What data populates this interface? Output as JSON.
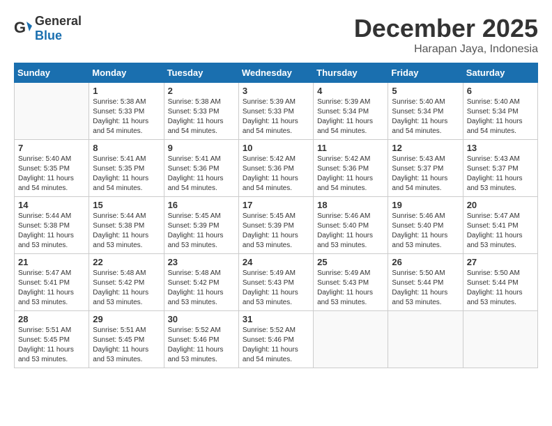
{
  "header": {
    "logo_general": "General",
    "logo_blue": "Blue",
    "month": "December 2025",
    "location": "Harapan Jaya, Indonesia"
  },
  "weekdays": [
    "Sunday",
    "Monday",
    "Tuesday",
    "Wednesday",
    "Thursday",
    "Friday",
    "Saturday"
  ],
  "weeks": [
    [
      {
        "day": "",
        "sunrise": "",
        "sunset": "",
        "daylight": ""
      },
      {
        "day": "1",
        "sunrise": "Sunrise: 5:38 AM",
        "sunset": "Sunset: 5:33 PM",
        "daylight": "Daylight: 11 hours and 54 minutes."
      },
      {
        "day": "2",
        "sunrise": "Sunrise: 5:38 AM",
        "sunset": "Sunset: 5:33 PM",
        "daylight": "Daylight: 11 hours and 54 minutes."
      },
      {
        "day": "3",
        "sunrise": "Sunrise: 5:39 AM",
        "sunset": "Sunset: 5:33 PM",
        "daylight": "Daylight: 11 hours and 54 minutes."
      },
      {
        "day": "4",
        "sunrise": "Sunrise: 5:39 AM",
        "sunset": "Sunset: 5:34 PM",
        "daylight": "Daylight: 11 hours and 54 minutes."
      },
      {
        "day": "5",
        "sunrise": "Sunrise: 5:40 AM",
        "sunset": "Sunset: 5:34 PM",
        "daylight": "Daylight: 11 hours and 54 minutes."
      },
      {
        "day": "6",
        "sunrise": "Sunrise: 5:40 AM",
        "sunset": "Sunset: 5:34 PM",
        "daylight": "Daylight: 11 hours and 54 minutes."
      }
    ],
    [
      {
        "day": "7",
        "sunrise": "Sunrise: 5:40 AM",
        "sunset": "Sunset: 5:35 PM",
        "daylight": "Daylight: 11 hours and 54 minutes."
      },
      {
        "day": "8",
        "sunrise": "Sunrise: 5:41 AM",
        "sunset": "Sunset: 5:35 PM",
        "daylight": "Daylight: 11 hours and 54 minutes."
      },
      {
        "day": "9",
        "sunrise": "Sunrise: 5:41 AM",
        "sunset": "Sunset: 5:36 PM",
        "daylight": "Daylight: 11 hours and 54 minutes."
      },
      {
        "day": "10",
        "sunrise": "Sunrise: 5:42 AM",
        "sunset": "Sunset: 5:36 PM",
        "daylight": "Daylight: 11 hours and 54 minutes."
      },
      {
        "day": "11",
        "sunrise": "Sunrise: 5:42 AM",
        "sunset": "Sunset: 5:36 PM",
        "daylight": "Daylight: 11 hours and 54 minutes."
      },
      {
        "day": "12",
        "sunrise": "Sunrise: 5:43 AM",
        "sunset": "Sunset: 5:37 PM",
        "daylight": "Daylight: 11 hours and 54 minutes."
      },
      {
        "day": "13",
        "sunrise": "Sunrise: 5:43 AM",
        "sunset": "Sunset: 5:37 PM",
        "daylight": "Daylight: 11 hours and 53 minutes."
      }
    ],
    [
      {
        "day": "14",
        "sunrise": "Sunrise: 5:44 AM",
        "sunset": "Sunset: 5:38 PM",
        "daylight": "Daylight: 11 hours and 53 minutes."
      },
      {
        "day": "15",
        "sunrise": "Sunrise: 5:44 AM",
        "sunset": "Sunset: 5:38 PM",
        "daylight": "Daylight: 11 hours and 53 minutes."
      },
      {
        "day": "16",
        "sunrise": "Sunrise: 5:45 AM",
        "sunset": "Sunset: 5:39 PM",
        "daylight": "Daylight: 11 hours and 53 minutes."
      },
      {
        "day": "17",
        "sunrise": "Sunrise: 5:45 AM",
        "sunset": "Sunset: 5:39 PM",
        "daylight": "Daylight: 11 hours and 53 minutes."
      },
      {
        "day": "18",
        "sunrise": "Sunrise: 5:46 AM",
        "sunset": "Sunset: 5:40 PM",
        "daylight": "Daylight: 11 hours and 53 minutes."
      },
      {
        "day": "19",
        "sunrise": "Sunrise: 5:46 AM",
        "sunset": "Sunset: 5:40 PM",
        "daylight": "Daylight: 11 hours and 53 minutes."
      },
      {
        "day": "20",
        "sunrise": "Sunrise: 5:47 AM",
        "sunset": "Sunset: 5:41 PM",
        "daylight": "Daylight: 11 hours and 53 minutes."
      }
    ],
    [
      {
        "day": "21",
        "sunrise": "Sunrise: 5:47 AM",
        "sunset": "Sunset: 5:41 PM",
        "daylight": "Daylight: 11 hours and 53 minutes."
      },
      {
        "day": "22",
        "sunrise": "Sunrise: 5:48 AM",
        "sunset": "Sunset: 5:42 PM",
        "daylight": "Daylight: 11 hours and 53 minutes."
      },
      {
        "day": "23",
        "sunrise": "Sunrise: 5:48 AM",
        "sunset": "Sunset: 5:42 PM",
        "daylight": "Daylight: 11 hours and 53 minutes."
      },
      {
        "day": "24",
        "sunrise": "Sunrise: 5:49 AM",
        "sunset": "Sunset: 5:43 PM",
        "daylight": "Daylight: 11 hours and 53 minutes."
      },
      {
        "day": "25",
        "sunrise": "Sunrise: 5:49 AM",
        "sunset": "Sunset: 5:43 PM",
        "daylight": "Daylight: 11 hours and 53 minutes."
      },
      {
        "day": "26",
        "sunrise": "Sunrise: 5:50 AM",
        "sunset": "Sunset: 5:44 PM",
        "daylight": "Daylight: 11 hours and 53 minutes."
      },
      {
        "day": "27",
        "sunrise": "Sunrise: 5:50 AM",
        "sunset": "Sunset: 5:44 PM",
        "daylight": "Daylight: 11 hours and 53 minutes."
      }
    ],
    [
      {
        "day": "28",
        "sunrise": "Sunrise: 5:51 AM",
        "sunset": "Sunset: 5:45 PM",
        "daylight": "Daylight: 11 hours and 53 minutes."
      },
      {
        "day": "29",
        "sunrise": "Sunrise: 5:51 AM",
        "sunset": "Sunset: 5:45 PM",
        "daylight": "Daylight: 11 hours and 53 minutes."
      },
      {
        "day": "30",
        "sunrise": "Sunrise: 5:52 AM",
        "sunset": "Sunset: 5:46 PM",
        "daylight": "Daylight: 11 hours and 53 minutes."
      },
      {
        "day": "31",
        "sunrise": "Sunrise: 5:52 AM",
        "sunset": "Sunset: 5:46 PM",
        "daylight": "Daylight: 11 hours and 54 minutes."
      },
      {
        "day": "",
        "sunrise": "",
        "sunset": "",
        "daylight": ""
      },
      {
        "day": "",
        "sunrise": "",
        "sunset": "",
        "daylight": ""
      },
      {
        "day": "",
        "sunrise": "",
        "sunset": "",
        "daylight": ""
      }
    ]
  ]
}
